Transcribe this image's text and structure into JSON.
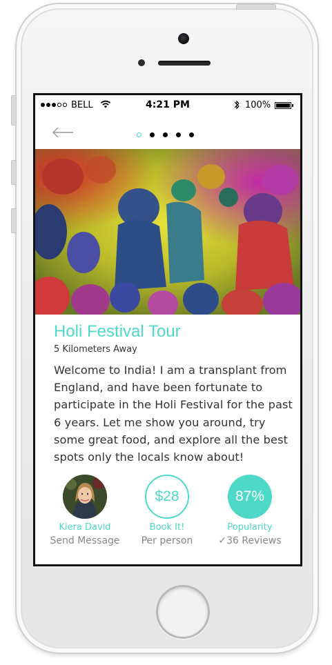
{
  "status_bar": {
    "carrier": "BELL",
    "time": "4:21 PM",
    "battery": "100%",
    "signal_bars": 3,
    "signal_max": 5
  },
  "header": {
    "back_icon": "back-arrow-icon",
    "pages": 5,
    "active_page": 1
  },
  "hero": {
    "image_icon": "hero-photo"
  },
  "tour": {
    "title": "Holi Festival Tour",
    "distance": "5 Kilometers Away",
    "description": "Welcome to India! I am a transplant from England, and have been fortunate to participate in the Holi Festival for the past 6 years. Let me show you around, try some great food, and explore all the best spots only the locals know about!"
  },
  "host": {
    "name": "Kiera David",
    "action": "Send Message"
  },
  "booking": {
    "price": "$28",
    "action": "Book It!",
    "unit": "Per person"
  },
  "popularity": {
    "value": "87%",
    "label": "Popularity",
    "reviews": "✓36 Reviews"
  },
  "colors": {
    "accent": "#4dd9c6",
    "text": "#333333",
    "muted": "#888888"
  }
}
